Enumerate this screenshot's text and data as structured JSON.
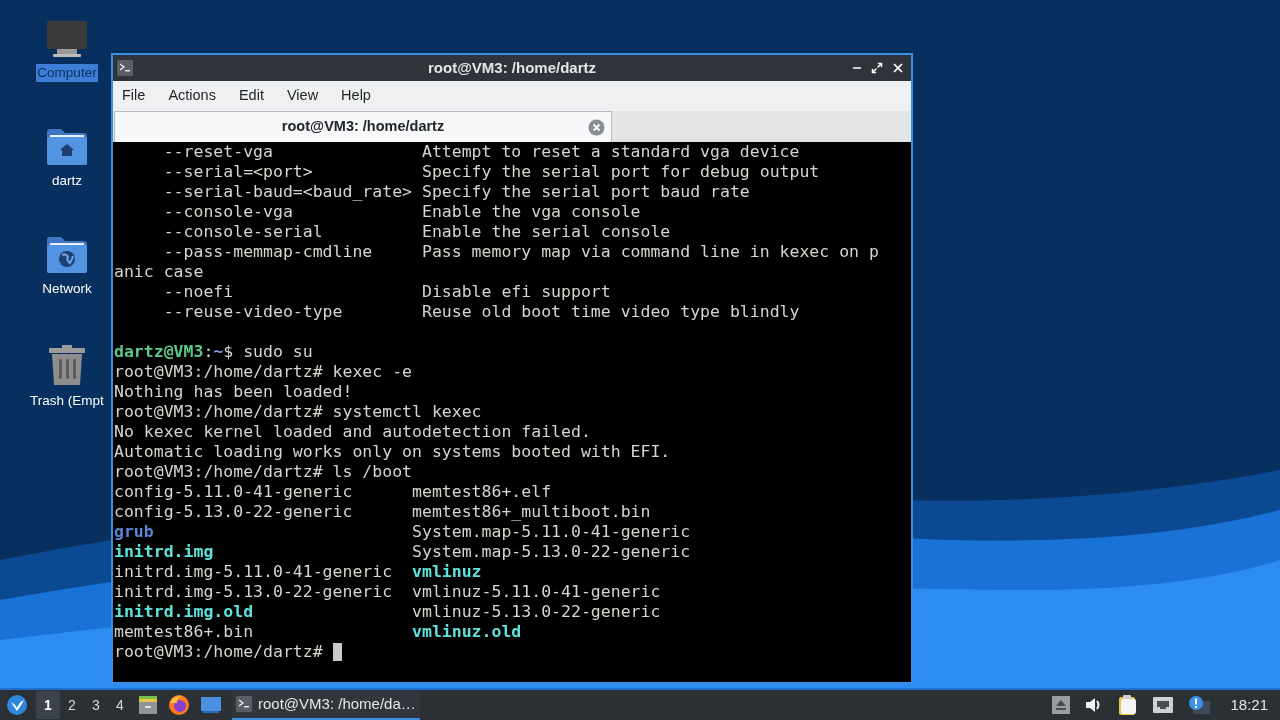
{
  "desktop_icons": [
    {
      "label": "Computer",
      "selected": true,
      "kind": "computer"
    },
    {
      "label": "dartz",
      "selected": false,
      "kind": "home"
    },
    {
      "label": "Network",
      "selected": false,
      "kind": "network"
    },
    {
      "label": "Trash (Empt",
      "selected": false,
      "kind": "trash"
    }
  ],
  "window": {
    "title": "root@VM3: /home/dartz",
    "menu": [
      "File",
      "Actions",
      "Edit",
      "View",
      "Help"
    ],
    "tabs": [
      {
        "label": "root@VM3: /home/dartz",
        "selected": true
      }
    ],
    "terminal": {
      "blocks": [
        {
          "lines": [
            {
              "segments": [
                {
                  "text": "     --reset-vga               Attempt to reset a standard vga device",
                  "kind": "plain"
                }
              ]
            },
            {
              "segments": [
                {
                  "text": "     --serial=<port>           Specify the serial port for debug output",
                  "kind": "plain"
                }
              ]
            },
            {
              "segments": [
                {
                  "text": "     --serial-baud=<baud_rate> Specify the serial port baud rate",
                  "kind": "plain"
                }
              ]
            },
            {
              "segments": [
                {
                  "text": "     --console-vga             Enable the vga console",
                  "kind": "plain"
                }
              ]
            },
            {
              "segments": [
                {
                  "text": "     --console-serial          Enable the serial console",
                  "kind": "plain"
                }
              ]
            },
            {
              "segments": [
                {
                  "text": "     --pass-memmap-cmdline     Pass memory map via command line in kexec on p",
                  "kind": "plain"
                }
              ]
            },
            {
              "segments": [
                {
                  "text": "anic case",
                  "kind": "plain"
                }
              ]
            },
            {
              "segments": [
                {
                  "text": "     --noefi                   Disable efi support",
                  "kind": "plain"
                }
              ]
            },
            {
              "segments": [
                {
                  "text": "     --reuse-video-type        Reuse old boot time video type blindly",
                  "kind": "plain"
                }
              ]
            }
          ]
        },
        {
          "lines": [
            {
              "segments": [
                {
                  "text": "dartz@VM3",
                  "kind": "user"
                },
                {
                  "text": ":",
                  "kind": "plain"
                },
                {
                  "text": "~",
                  "kind": "path"
                },
                {
                  "text": "$ sudo su",
                  "kind": "plain"
                }
              ]
            },
            {
              "segments": [
                {
                  "text": "root@VM3:/home/dartz# kexec -e",
                  "kind": "plain"
                }
              ]
            },
            {
              "segments": [
                {
                  "text": "Nothing has been loaded!",
                  "kind": "plain"
                }
              ]
            },
            {
              "segments": [
                {
                  "text": "root@VM3:/home/dartz# systemctl kexec",
                  "kind": "plain"
                }
              ]
            },
            {
              "segments": [
                {
                  "text": "No kexec kernel loaded and autodetection failed.",
                  "kind": "plain"
                }
              ]
            },
            {
              "segments": [
                {
                  "text": "Automatic loading works only on systems booted with EFI.",
                  "kind": "plain"
                }
              ]
            },
            {
              "segments": [
                {
                  "text": "root@VM3:/home/dartz# ls /boot",
                  "kind": "plain"
                }
              ]
            },
            {
              "segments": [
                {
                  "text": "config-5.11.0-41-generic      memtest86+.elf",
                  "kind": "plain"
                }
              ]
            },
            {
              "segments": [
                {
                  "text": "config-5.13.0-22-generic      memtest86+_multiboot.bin",
                  "kind": "plain"
                }
              ]
            },
            {
              "segments": [
                {
                  "text": "grub",
                  "kind": "dir"
                },
                {
                  "text": "                          System.map-5.11.0-41-generic",
                  "kind": "plain"
                }
              ]
            },
            {
              "segments": [
                {
                  "text": "initrd.img",
                  "kind": "link"
                },
                {
                  "text": "                    System.map-5.13.0-22-generic",
                  "kind": "plain"
                }
              ]
            },
            {
              "segments": [
                {
                  "text": "initrd.img-5.11.0-41-generic  ",
                  "kind": "plain"
                },
                {
                  "text": "vmlinuz",
                  "kind": "link"
                }
              ]
            },
            {
              "segments": [
                {
                  "text": "initrd.img-5.13.0-22-generic  vmlinuz-5.11.0-41-generic",
                  "kind": "plain"
                }
              ]
            },
            {
              "segments": [
                {
                  "text": "initrd.img.old",
                  "kind": "link"
                },
                {
                  "text": "                vmlinuz-5.13.0-22-generic",
                  "kind": "plain"
                }
              ]
            },
            {
              "segments": [
                {
                  "text": "memtest86+.bin                ",
                  "kind": "plain"
                },
                {
                  "text": "vmlinuz.old",
                  "kind": "link"
                }
              ]
            },
            {
              "cursor": true,
              "segments": [
                {
                  "text": "root@VM3:/home/dartz# ",
                  "kind": "plain"
                }
              ]
            }
          ]
        }
      ]
    }
  },
  "taskbar": {
    "workspaces": [
      {
        "label": "1",
        "selected": true
      },
      {
        "label": "2",
        "selected": false
      },
      {
        "label": "3",
        "selected": false
      },
      {
        "label": "4",
        "selected": false
      }
    ],
    "launchers": [
      {
        "kind": "files"
      },
      {
        "kind": "browser"
      },
      {
        "kind": "desktop"
      }
    ],
    "tasks": [
      {
        "label": "root@VM3: /home/da…",
        "selected": true
      }
    ],
    "tray": [
      {
        "kind": "eject"
      },
      {
        "kind": "volume"
      },
      {
        "kind": "clipboard"
      },
      {
        "kind": "network"
      },
      {
        "kind": "notification"
      }
    ],
    "clock": "18:21"
  }
}
